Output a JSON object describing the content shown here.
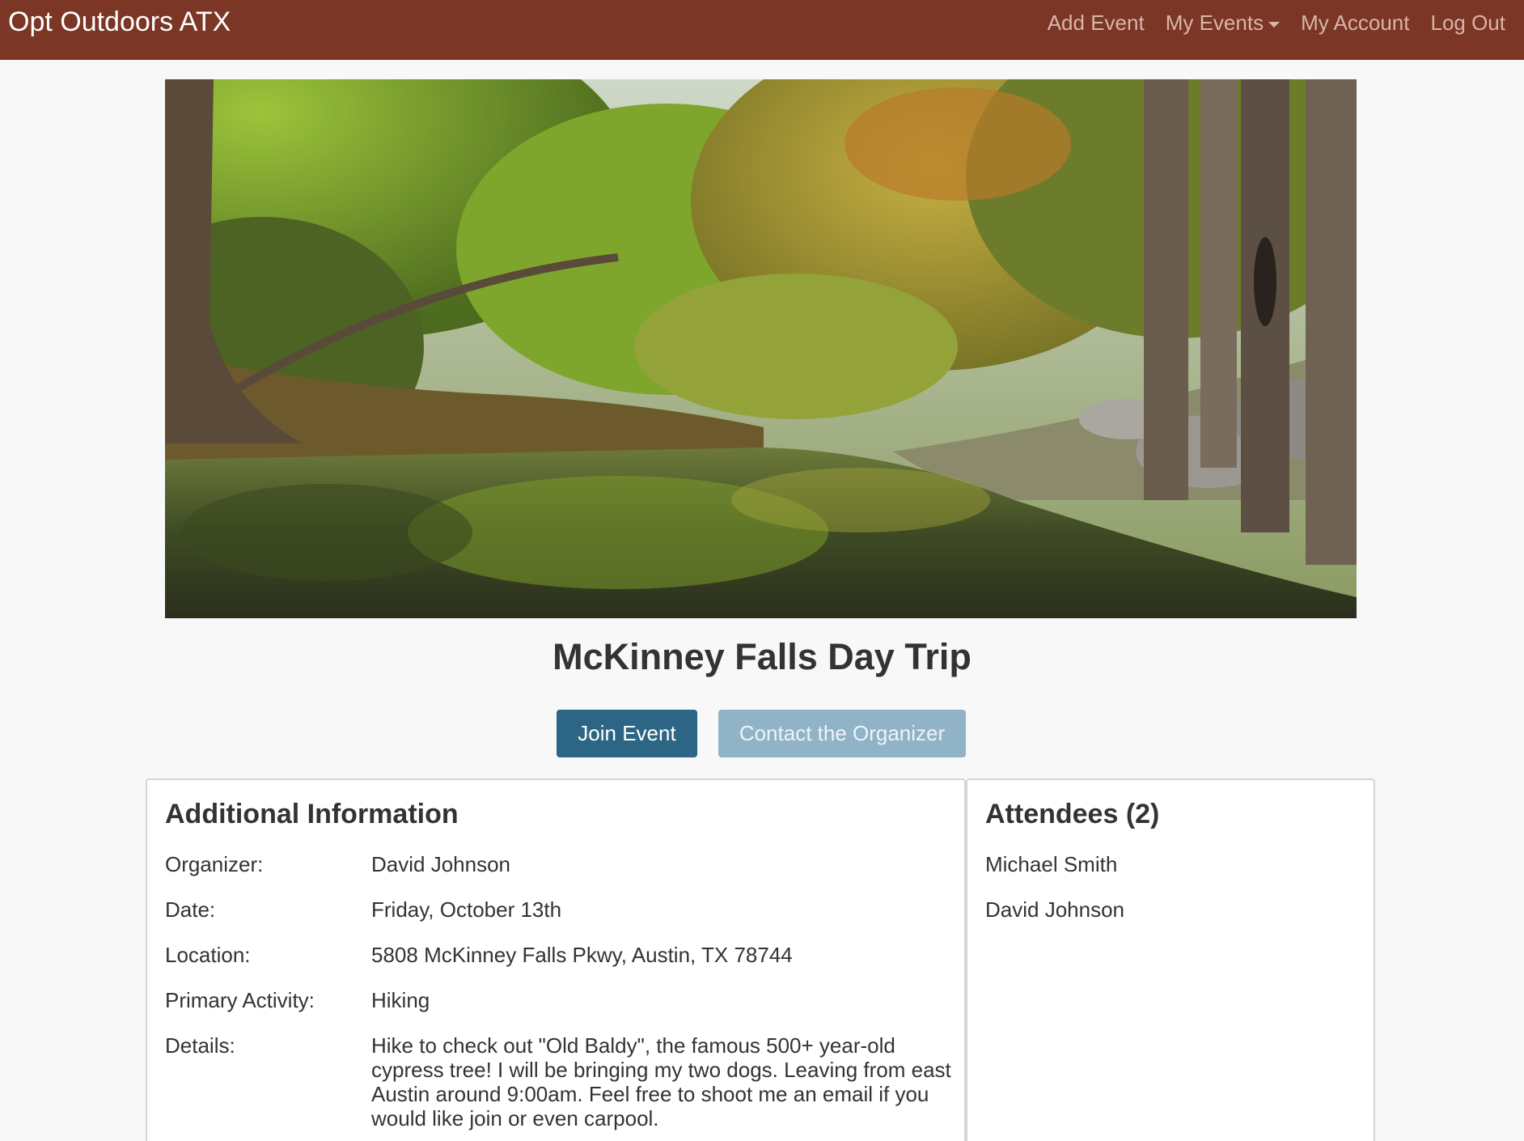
{
  "navbar": {
    "brand": "Opt Outdoors ATX",
    "links": {
      "add_event": "Add Event",
      "my_events": "My Events",
      "my_account": "My Account",
      "log_out": "Log Out"
    },
    "background_color": "#7b3625"
  },
  "event": {
    "title": "McKinney Falls Day Trip",
    "join_button": "Join Event",
    "contact_button": "Contact the Organizer"
  },
  "info": {
    "heading": "Additional Information",
    "rows": [
      {
        "label": "Organizer:",
        "value": "David Johnson"
      },
      {
        "label": "Date:",
        "value": "Friday, October 13th"
      },
      {
        "label": "Location:",
        "value": "5808 McKinney Falls Pkwy, Austin, TX 78744"
      },
      {
        "label": "Primary Activity:",
        "value": "Hiking"
      },
      {
        "label": "Details:",
        "value": "Hike to check out \"Old Baldy\", the famous 500+ year-old cypress tree! I will be bringing my two dogs. Leaving from east Austin around 9:00am. Feel free to shoot me an email if you would like join or even carpool."
      }
    ]
  },
  "attendees": {
    "heading": "Attendees (2)",
    "names": [
      "Michael Smith",
      "David Johnson"
    ]
  },
  "colors": {
    "join_button": "#2d6684",
    "contact_button": "#90b3c7"
  }
}
